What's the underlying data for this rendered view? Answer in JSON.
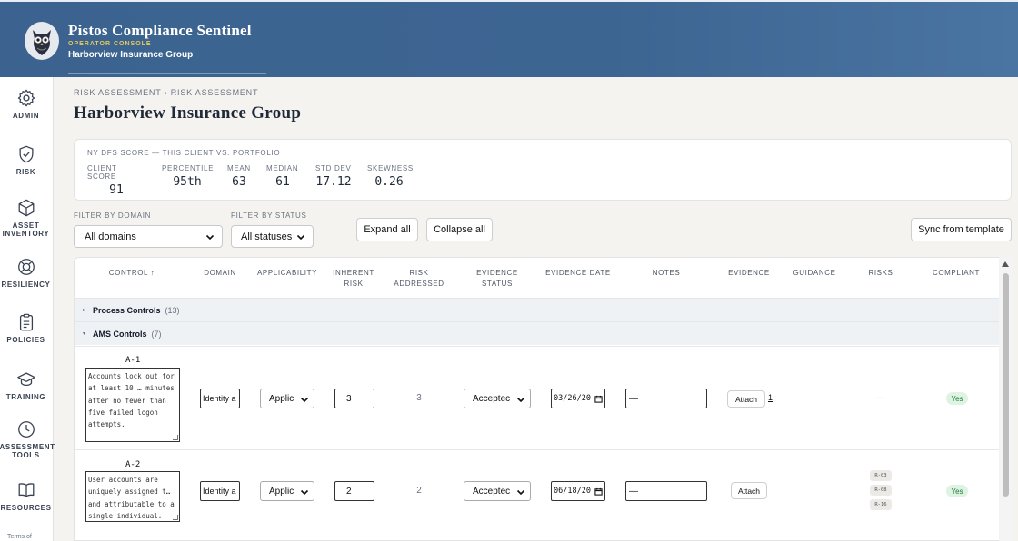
{
  "header": {
    "app_title": "Pistos Compliance Sentinel",
    "console_label": "OPERATOR CONSOLE",
    "client_name": "Harborview Insurance Group",
    "logo_caption": "Pistos"
  },
  "sidebar": {
    "items": [
      {
        "label": "ADMIN",
        "icon": "gear-icon"
      },
      {
        "label": "RISK",
        "icon": "shield-check-icon"
      },
      {
        "label": "ASSET INVENTORY",
        "icon": "cube-icon"
      },
      {
        "label": "RESILIENCY",
        "icon": "lifebuoy-icon"
      },
      {
        "label": "POLICIES",
        "icon": "clipboard-icon"
      },
      {
        "label": "TRAINING",
        "icon": "graduation-cap-icon"
      },
      {
        "label": "ASSESSMENT TOOLS",
        "icon": "clock-icon"
      },
      {
        "label": "RESOURCES",
        "icon": "book-icon"
      }
    ],
    "terms": "Terms of"
  },
  "breadcrumb": "RISK ASSESSMENT › RISK ASSESSMENT",
  "page_title": "Harborview Insurance Group",
  "score_card": {
    "heading": "NY DFS SCORE — THIS CLIENT VS. PORTFOLIO",
    "stats": [
      {
        "label": "CLIENT SCORE",
        "value": "91"
      },
      {
        "label": "PERCENTILE",
        "value": "95th"
      },
      {
        "label": "MEAN",
        "value": "63"
      },
      {
        "label": "MEDIAN",
        "value": "61"
      },
      {
        "label": "STD DEV",
        "value": "17.12"
      },
      {
        "label": "SKEWNESS",
        "value": "0.26"
      }
    ]
  },
  "filters": {
    "domain_label": "FILTER BY DOMAIN",
    "domain_value": "All domains",
    "status_label": "FILTER BY STATUS",
    "status_value": "All statuses",
    "expand_all": "Expand all",
    "collapse_all": "Collapse all",
    "sync": "Sync from template"
  },
  "table": {
    "columns": [
      "CONTROL ↑",
      "DOMAIN",
      "APPLICABILITY",
      "INHERENT RISK",
      "RISK ADDRESSED",
      "EVIDENCE STATUS",
      "EVIDENCE DATE",
      "NOTES",
      "EVIDENCE",
      "GUIDANCE",
      "RISKS",
      "COMPLIANT"
    ],
    "groups": [
      {
        "name": "Process Controls",
        "count": "(13)",
        "expanded": false
      },
      {
        "name": "AMS Controls",
        "count": "(7)",
        "expanded": true
      }
    ],
    "rows": [
      {
        "id": "A-1",
        "text": "Accounts lock out for at least 10 … minutes after no fewer than five failed logon attempts.",
        "domain": "Identity a",
        "applicability": "Applic",
        "inherent_risk": "3",
        "risk_addressed": "3",
        "evidence_status": "Acceptec",
        "evidence_date": "03/26/20",
        "notes": "—",
        "attach_label": "Attach",
        "attach_count": "1",
        "risks": [],
        "risks_empty": "—",
        "compliant": "Yes"
      },
      {
        "id": "A-2",
        "text": "User accounts are uniquely assigned t… and attributable to a single individual.",
        "domain": "Identity a",
        "applicability": "Applic",
        "inherent_risk": "2",
        "risk_addressed": "2",
        "evidence_status": "Acceptec",
        "evidence_date": "06/18/20",
        "notes": "—",
        "attach_label": "Attach",
        "attach_count": "",
        "risks": [
          "R-03",
          "R-08",
          "R-16"
        ],
        "compliant": "Yes"
      }
    ]
  }
}
